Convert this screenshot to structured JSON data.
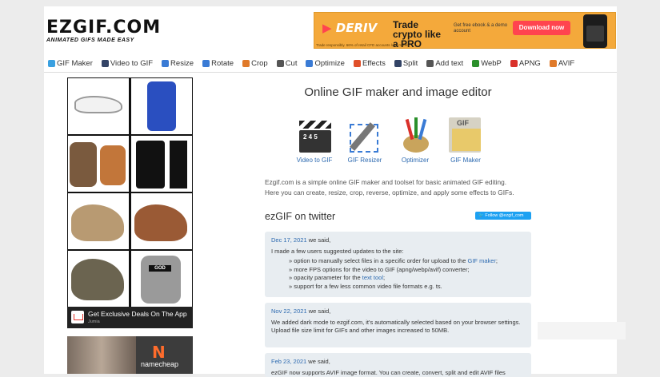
{
  "logo": {
    "main": "EZGIF.COM",
    "tagline": "ANIMATED GIFS MADE EASY"
  },
  "top_ad": {
    "brand": "DERIV",
    "headline": "Trade crypto like a PRO",
    "note": "Get free ebook & a demo account",
    "button": "Download now",
    "footnote": "Trade responsibly. 66% of retail CFD accounts lose money."
  },
  "nav": [
    {
      "label": "GIF Maker",
      "color": "#3aa0e0"
    },
    {
      "label": "Video to GIF",
      "color": "#334466"
    },
    {
      "label": "Resize",
      "color": "#3a7bd5"
    },
    {
      "label": "Rotate",
      "color": "#3a7bd5"
    },
    {
      "label": "Crop",
      "color": "#e07a2a"
    },
    {
      "label": "Cut",
      "color": "#555555"
    },
    {
      "label": "Optimize",
      "color": "#3a7bd5"
    },
    {
      "label": "Effects",
      "color": "#e0502a"
    },
    {
      "label": "Split",
      "color": "#334466"
    },
    {
      "label": "Add text",
      "color": "#555555"
    },
    {
      "label": "WebP",
      "color": "#2a8f2a"
    },
    {
      "label": "APNG",
      "color": "#d9302a"
    },
    {
      "label": "AVIF",
      "color": "#e07a2a"
    }
  ],
  "side_ad": {
    "caption": "Get Exclusive Deals On The App",
    "brand": "Jumia",
    "x": "X"
  },
  "side_ad2": {
    "brand": "namecheap"
  },
  "main": {
    "title": "Online GIF maker and image editor",
    "tools": [
      {
        "label": "Video to GIF",
        "icon": "clapperboard-icon"
      },
      {
        "label": "GIF Resizer",
        "icon": "resize-pen-icon"
      },
      {
        "label": "Optimizer",
        "icon": "paint-brushes-icon"
      },
      {
        "label": "GIF Maker",
        "icon": "gif-film-icon"
      }
    ],
    "intro_1": "Ezgif.com is a simple online GIF maker and toolset for basic animated GIF editing.",
    "intro_2": "Here you can create, resize, crop, reverse, optimize, and apply some effects to GIFs.",
    "twitter_heading": "ezGIF on twitter",
    "follow_button": "Follow @ezgif_com"
  },
  "tweets": [
    {
      "date": "Dec 17, 2021",
      "said": "we said,",
      "intro": "I made a few users suggested updates to the site:",
      "items": [
        {
          "text": "option to manually select files in a specific order for upload to the ",
          "link": "GIF maker",
          "after": ";"
        },
        {
          "text": "more FPS options for the video to GIF (apng/webp/avif) converter;",
          "link": "",
          "after": ""
        },
        {
          "text": "opacity parameter for the ",
          "link": "text tool",
          "after": ";"
        },
        {
          "text": "support for a few less common video file formats e.g. ts.",
          "link": "",
          "after": ""
        }
      ]
    },
    {
      "date": "Nov 22, 2021",
      "said": "we said,",
      "line1": "We added dark mode to ezgif.com, it's automatically selected based on your browser settings.",
      "line2": "Upload file size limit for GIFs and other images increased to 50MB."
    },
    {
      "date": "Feb 23, 2021",
      "said": "we said,",
      "line1": "ezGIF now supports AVIF image format. You can create, convert, split and edit AVIF files"
    }
  ]
}
